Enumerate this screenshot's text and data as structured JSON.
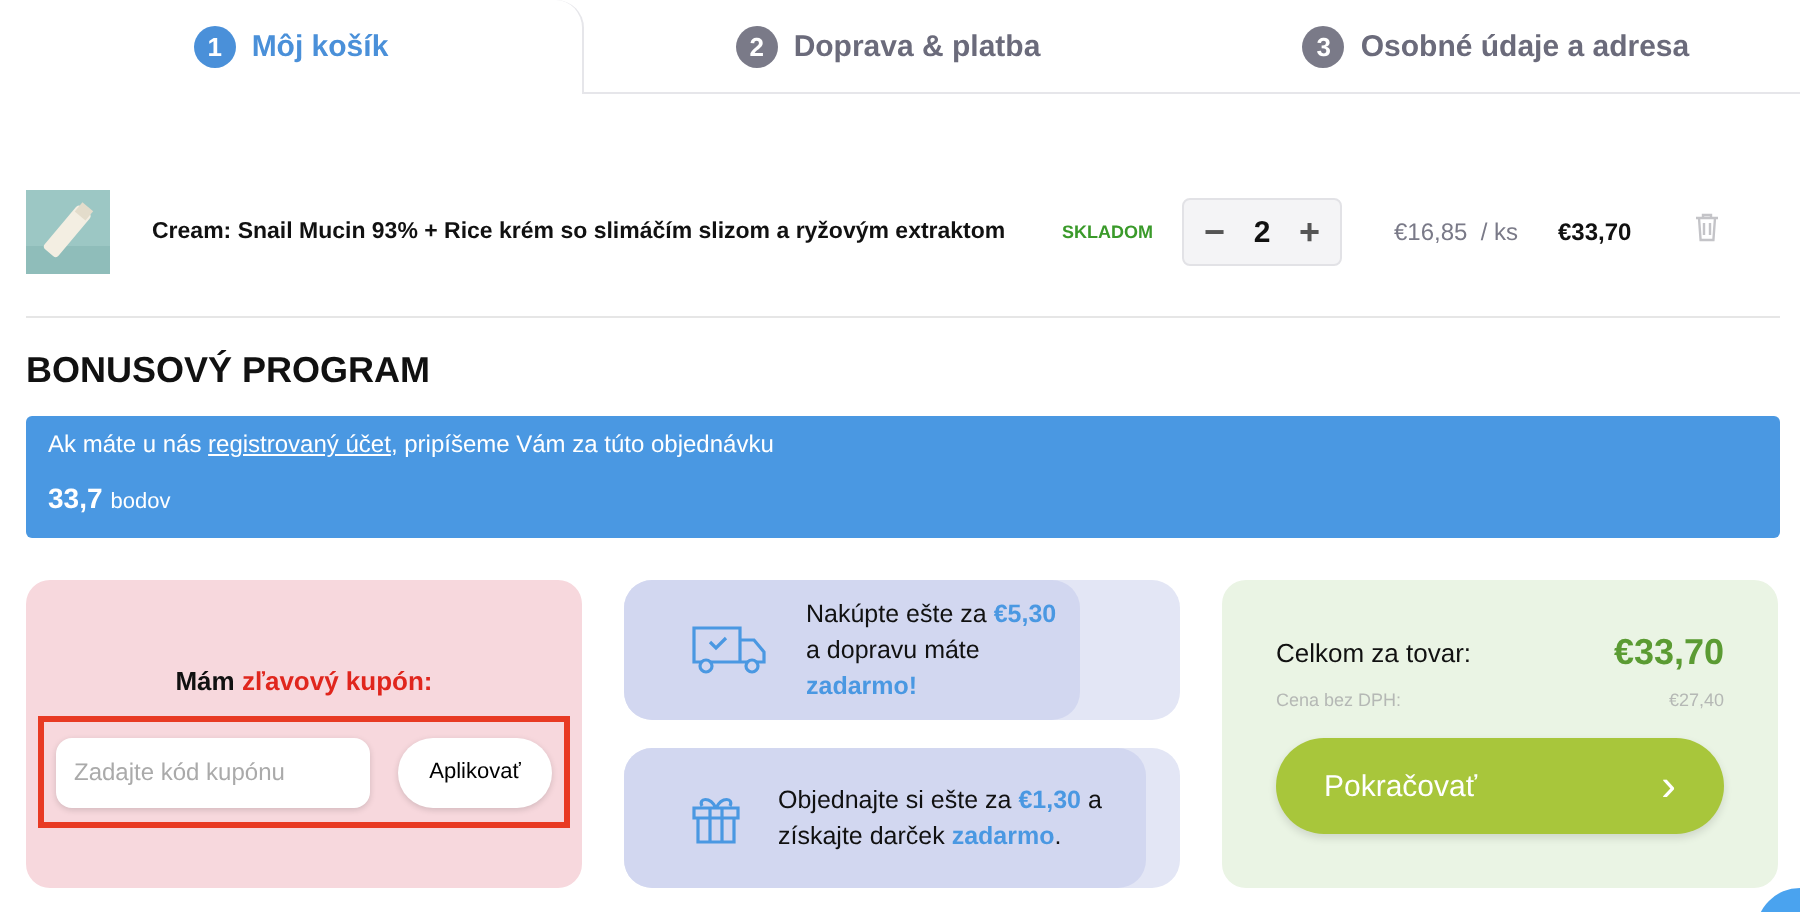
{
  "steps": [
    {
      "number": "1",
      "label": "Môj košík",
      "selected": true
    },
    {
      "number": "2",
      "label": "Doprava & platba",
      "selected": false
    },
    {
      "number": "3",
      "label": "Osobné údaje a adresa",
      "selected": false
    }
  ],
  "cart_items": [
    {
      "name": "Cream: Snail Mucin 93% + Rice krém so slimáčím slizom a ryžovým extraktom",
      "stock": "SKLADOM",
      "minus": "−",
      "quantity": "2",
      "plus": "+",
      "unit_price": "€16,85",
      "unit": "/ ks",
      "total": "€33,70"
    }
  ],
  "bonus": {
    "title": "BONUSOVÝ PROGRAM",
    "text_before": "Ak máte u nás ",
    "link": "registrovaný účet",
    "text_after": ", pripíšeme Vám za túto objednávku",
    "points": "33,7",
    "points_unit": "bodov"
  },
  "coupon": {
    "title": "Mám **zľavový kupón:**",
    "placeholder": "Zadajte kód kupónu",
    "button": "Aplikovať",
    "highlighted": true
  },
  "info_cards": [
    {
      "kind": "truck",
      "text": "Nakúpte ešte za **€5,30**\na dopravu máte **zadarmo!**",
      "level": 0.82
    },
    {
      "kind": "gift",
      "text": "Objednajte si ešte za **€1,30** a\nzískajte darček **zadarmo**.",
      "level": 0.94
    }
  ],
  "summary": {
    "total_label": "Celkom za tovar:",
    "total": "€33,70",
    "net_label": "Cena bez DPH:",
    "net": "€27,40",
    "button": "Pokračovať",
    "button_icon": "›"
  }
}
